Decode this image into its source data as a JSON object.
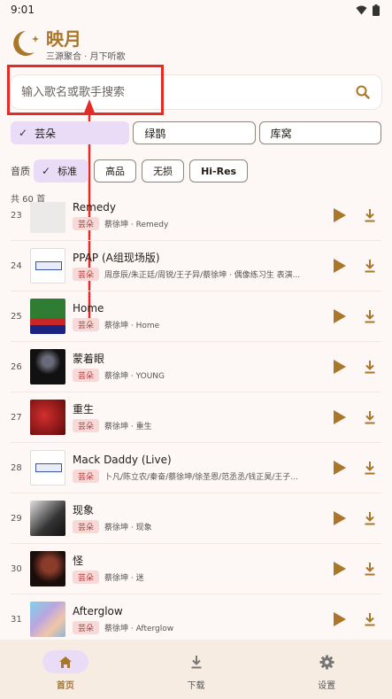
{
  "status_bar": {
    "time": "9:01"
  },
  "header": {
    "title": "映月",
    "subtitle": "三源聚合 · 月下听歌"
  },
  "search": {
    "placeholder": "输入歌名或歌手搜索",
    "value": ""
  },
  "sources": [
    {
      "label": "芸朵",
      "selected": true
    },
    {
      "label": "绿鹊",
      "selected": false
    },
    {
      "label": "库窝",
      "selected": false
    }
  ],
  "quality": {
    "label": "音质",
    "options": [
      {
        "label": "标准",
        "selected": true
      },
      {
        "label": "高品",
        "selected": false
      },
      {
        "label": "无损",
        "selected": false
      },
      {
        "label": "Hi-Res",
        "selected": false
      }
    ]
  },
  "result_count": "共 60 首",
  "songs": [
    {
      "index": "23",
      "title": "Remedy",
      "source": "芸朵",
      "artist": "蔡徐坤 · Remedy",
      "cover": "light"
    },
    {
      "index": "24",
      "title": "PPAP (A组现场版)",
      "source": "芸朵",
      "artist": "周彦辰/朱正廷/周锐/王子异/蔡徐坤 · 偶像练习生 表演...",
      "cover": "banner"
    },
    {
      "index": "25",
      "title": "Home",
      "source": "芸朵",
      "artist": "蔡徐坤 · Home",
      "cover": "home"
    },
    {
      "index": "26",
      "title": "蒙着眼",
      "source": "芸朵",
      "artist": "蔡徐坤 · YOUNG",
      "cover": "dark"
    },
    {
      "index": "27",
      "title": "重生",
      "source": "芸朵",
      "artist": "蔡徐坤 · 重生",
      "cover": "red"
    },
    {
      "index": "28",
      "title": "Mack Daddy (Live)",
      "source": "芸朵",
      "artist": "卜凡/陈立农/秦奋/蔡徐坤/徐圣恩/范丞丞/钱正昊/王子...",
      "cover": "banner"
    },
    {
      "index": "29",
      "title": "现象",
      "source": "芸朵",
      "artist": "蔡徐坤 · 现象",
      "cover": "bw"
    },
    {
      "index": "30",
      "title": "怪",
      "source": "芸朵",
      "artist": "蔡徐坤 · 迷",
      "cover": "portrait"
    },
    {
      "index": "31",
      "title": "Afterglow",
      "source": "芸朵",
      "artist": "蔡徐坤 · Afterglow",
      "cover": "holo"
    }
  ],
  "bottom_nav": [
    {
      "label": "首页",
      "icon": "home-icon",
      "active": true
    },
    {
      "label": "下载",
      "icon": "download-icon",
      "active": false
    },
    {
      "label": "设置",
      "icon": "gear-icon",
      "active": false
    }
  ],
  "colors": {
    "accent": "#a9762a",
    "chip_selected": "#eadcf7",
    "badge_bg": "#f7d9d8",
    "annotation": "#e42b26"
  }
}
